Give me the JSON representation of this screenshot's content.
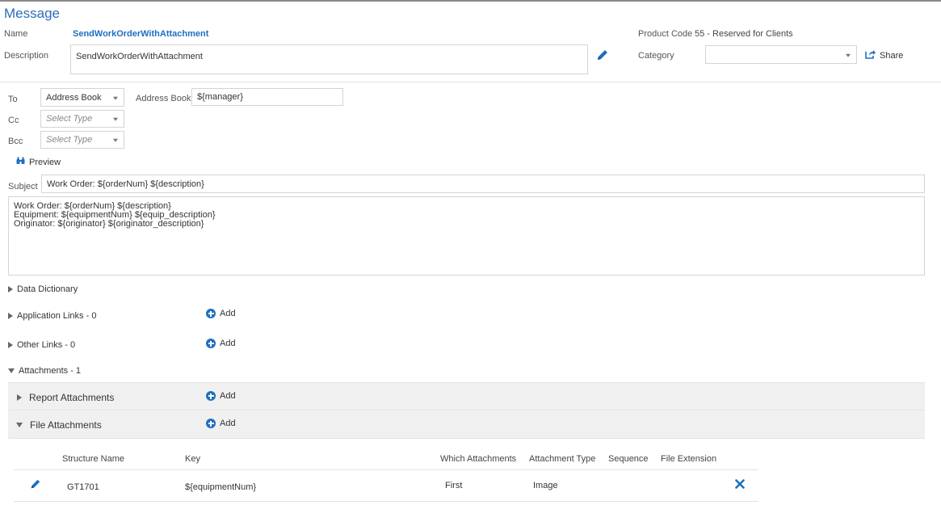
{
  "header": {
    "title": "Message",
    "name_label": "Name",
    "name_value": "SendWorkOrderWithAttachment",
    "description_label": "Description",
    "description_value": "SendWorkOrderWithAttachment",
    "product_code_label": "Product Code",
    "product_code_value": "55 - Reserved for Clients",
    "category_label": "Category",
    "category_value": "",
    "share_label": "Share"
  },
  "recipients": {
    "to_label": "To",
    "to_type": "Address Book",
    "address_book_label": "Address Book",
    "address_book_value": "${manager}",
    "cc_label": "Cc",
    "cc_placeholder": "Select Type",
    "bcc_label": "Bcc",
    "bcc_placeholder": "Select Type",
    "preview_label": "Preview"
  },
  "subject": {
    "label": "Subject",
    "value": "Work Order: ${orderNum} ${description}"
  },
  "body": {
    "lines": [
      "Work Order: ${orderNum} ${description}",
      "Equipment: ${equipmentNum} ${equip_description}",
      "Originator: ${originator} ${originator_description}"
    ]
  },
  "sections": {
    "data_dictionary": "Data Dictionary",
    "application_links": "Application Links - ",
    "application_links_count": "0",
    "other_links": "Other Links - ",
    "other_links_count": "0",
    "attachments": "Attachments - ",
    "attachments_count": "1",
    "report_attachments": "Report Attachments",
    "file_attachments": "File Attachments",
    "add_label": "Add"
  },
  "table": {
    "headers": [
      "Structure Name",
      "Key",
      "Which Attachments",
      "Attachment Type",
      "Sequence",
      "File Extension"
    ],
    "rows": [
      {
        "structure_name": "GT1701",
        "key": "${equipmentNum}",
        "which": "First",
        "type": "Image",
        "sequence": "",
        "extension": ""
      }
    ]
  },
  "colors": {
    "accent": "#1f6fc0",
    "title": "#2a6ebb",
    "band": "#f0f0f0"
  }
}
